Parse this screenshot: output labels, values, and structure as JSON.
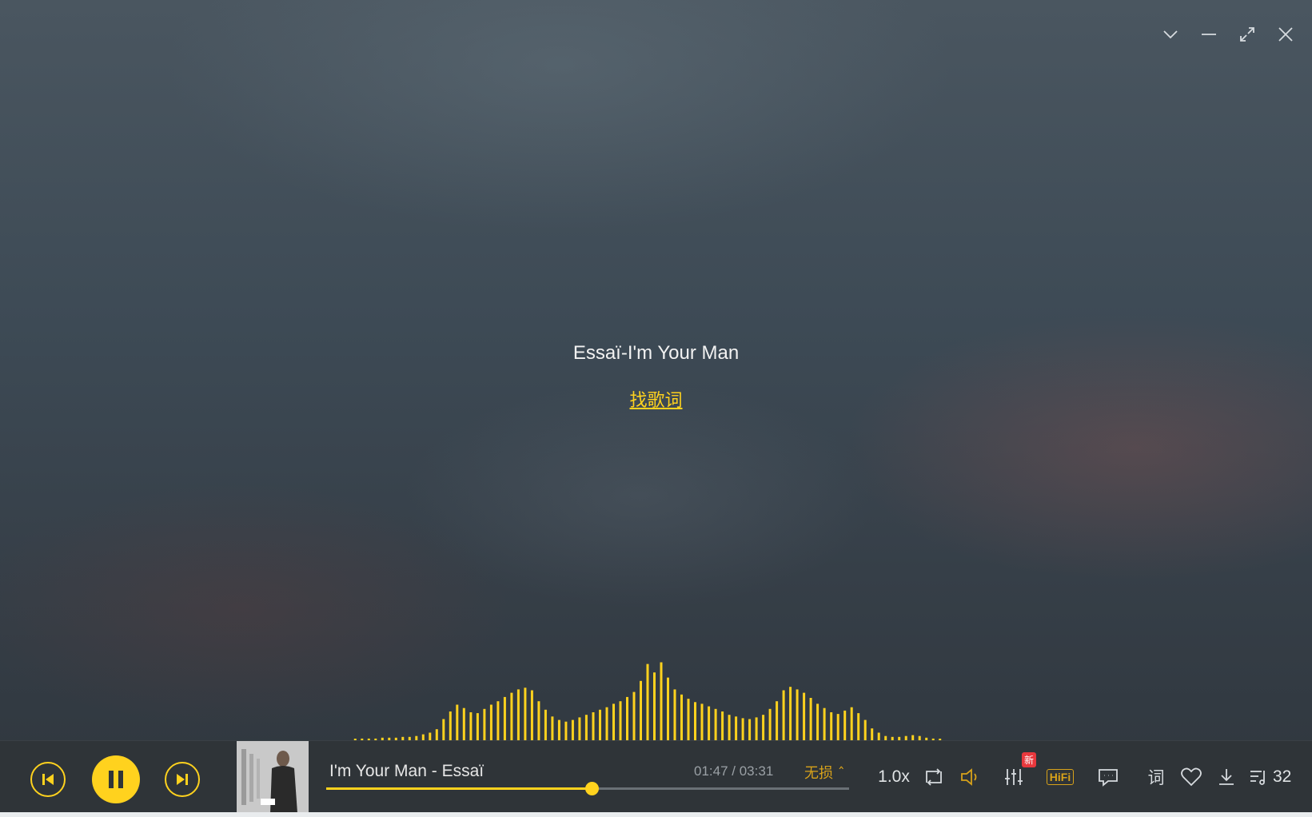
{
  "window": {
    "controls": [
      "collapse-icon",
      "minimize-icon",
      "fullscreen-icon",
      "close-icon"
    ]
  },
  "lyrics_panel": {
    "song_heading": "Essaï-I'm Your Man",
    "find_lyrics": "找歌词"
  },
  "spectrum": {
    "color": "#ffd21e",
    "levels": [
      1,
      2,
      2,
      2,
      3,
      3,
      3,
      4,
      4,
      5,
      7,
      9,
      13,
      25,
      34,
      42,
      38,
      33,
      32,
      37,
      42,
      46,
      51,
      56,
      60,
      62,
      59,
      46,
      36,
      28,
      24,
      22,
      24,
      27,
      30,
      33,
      36,
      39,
      43,
      46,
      51,
      57,
      70,
      90,
      80,
      92,
      74,
      60,
      54,
      49,
      45,
      43,
      40,
      37,
      34,
      30,
      28,
      26,
      25,
      27,
      30,
      37,
      46,
      59,
      63,
      60,
      56,
      50,
      43,
      38,
      33,
      31,
      35,
      39,
      32,
      24,
      14,
      9,
      5,
      4,
      4,
      5,
      6,
      5,
      3,
      2,
      1
    ]
  },
  "player": {
    "track_title": "I'm Your Man - Essaï",
    "current_time": "01:47",
    "total_time": "/ 03:31",
    "progress": 0.507,
    "quality": "无损 ˆ",
    "speed": "1.0x",
    "hifi_label": "HiFi",
    "new_badge": "新",
    "lyrics_toggle": "词",
    "queue_count": "32",
    "colors": {
      "accent": "#ffd21e",
      "quality": "#d8a21a",
      "badge": "#e8383d"
    }
  }
}
